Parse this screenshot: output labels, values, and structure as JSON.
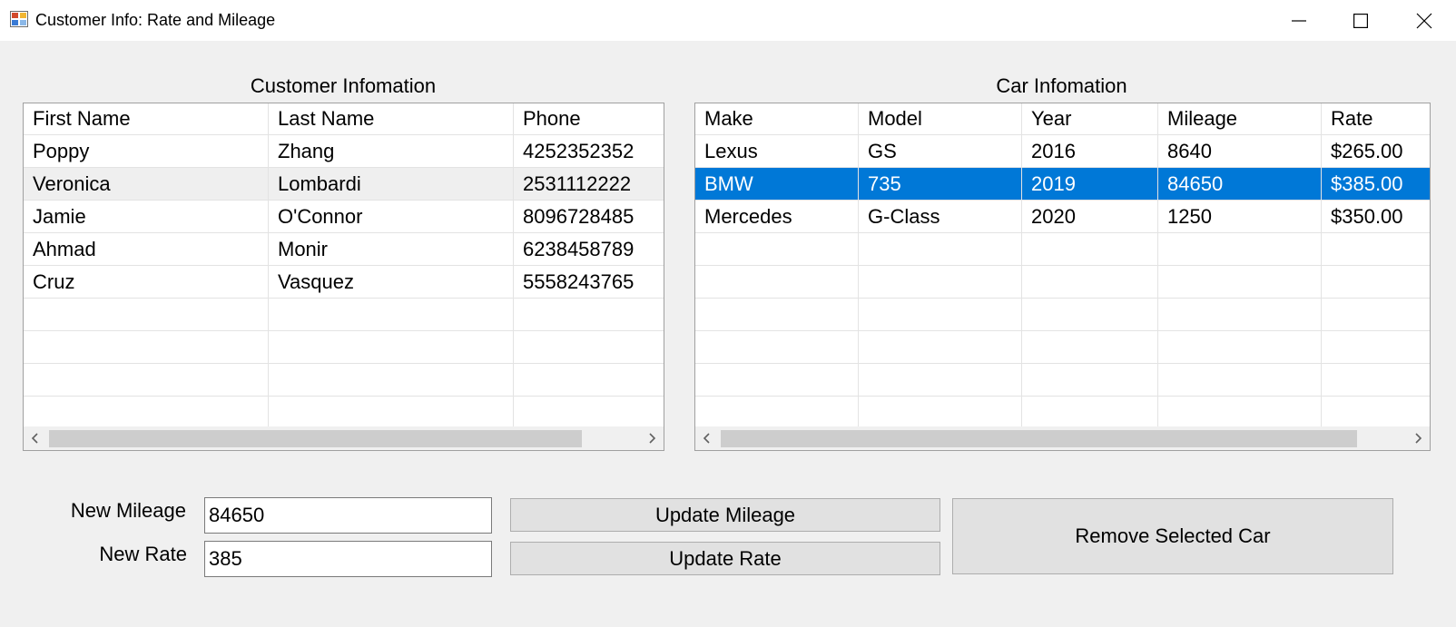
{
  "window": {
    "title": "Customer Info: Rate and Mileage"
  },
  "customer_panel": {
    "title": "Customer Infomation",
    "columns": [
      "First Name",
      "Last Name",
      "Phone"
    ],
    "rows": [
      [
        "Poppy",
        "Zhang",
        "4252352352"
      ],
      [
        "Veronica",
        "Lombardi",
        "2531112222"
      ],
      [
        "Jamie",
        "O'Connor",
        "8096728485"
      ],
      [
        "Ahmad",
        "Monir",
        "6238458789"
      ],
      [
        "Cruz",
        "Vasquez",
        "5558243765"
      ]
    ]
  },
  "car_panel": {
    "title": "Car Infomation",
    "columns": [
      "Make",
      "Model",
      "Year",
      "Mileage",
      "Rate"
    ],
    "rows": [
      [
        "Lexus",
        "GS",
        "2016",
        "8640",
        "$265.00"
      ],
      [
        "BMW",
        "735",
        "2019",
        "84650",
        "$385.00"
      ],
      [
        "Mercedes",
        "G-Class",
        "2020",
        "1250",
        "$350.00"
      ]
    ],
    "selected_row": 1
  },
  "form": {
    "mileage_label": "New Mileage",
    "mileage_value": "84650",
    "rate_label": "New Rate",
    "rate_value": "385",
    "update_mileage_label": "Update Mileage",
    "update_rate_label": "Update Rate",
    "remove_car_label": "Remove Selected Car"
  },
  "colors": {
    "selection": "#0078d7",
    "alt_row": "#efefef",
    "background": "#f0f0f0"
  }
}
